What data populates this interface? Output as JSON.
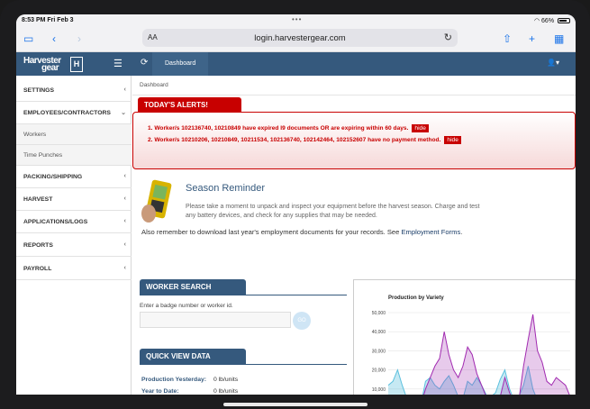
{
  "status_bar": {
    "time": "8:53 PM  Fri Feb 3",
    "battery": "66%"
  },
  "browser": {
    "text_size": "AA",
    "url": "login.harvestergear.com"
  },
  "header": {
    "logo_line1": "Harvester",
    "logo_line2": "gear",
    "logo_mark": "H",
    "nav_tab": "Dashboard"
  },
  "sidebar": {
    "items": [
      {
        "label": "SETTINGS"
      },
      {
        "label": "EMPLOYEES/CONTRACTORS"
      },
      {
        "label": "PACKING/SHIPPING"
      },
      {
        "label": "HARVEST"
      },
      {
        "label": "APPLICATIONS/LOGS"
      },
      {
        "label": "REPORTS"
      },
      {
        "label": "PAYROLL"
      }
    ],
    "subitems": [
      {
        "label": "Workers"
      },
      {
        "label": "Time Punches"
      }
    ]
  },
  "breadcrumb": "Dashboard",
  "alerts": {
    "title": "TODAY'S ALERTS!",
    "items": [
      {
        "text": "1.  Worker/s 102136740, 10210849 have expired I9 documents OR are expiring within 60 days.",
        "hide": "hide"
      },
      {
        "text": "2.  Worker/s 10210206, 10210849, 10211534, 102136740, 102142464, 102152607 have no payment method.",
        "hide": "hide"
      }
    ]
  },
  "reminder": {
    "title": "Season Reminder",
    "text": "Please take a moment to unpack and inspect your equipment before the harvest season. Charge and test any battery devices, and check for any supplies that may be needed.",
    "docs_text": "Also remember to download last year's employment documents for your records. See ",
    "docs_link": "Employment Forms",
    "docs_end": "."
  },
  "worker_search": {
    "title": "WORKER SEARCH",
    "label": "Enter a badge number or worker id.",
    "go": "GO"
  },
  "quick_view": {
    "title": "QUICK VIEW DATA",
    "rows": [
      {
        "label": "Production Yesterday:",
        "value": "0 lb/units"
      },
      {
        "label": "Year to Date:",
        "value": "0 lb/units"
      }
    ]
  },
  "colors": {
    "header": "#35597d",
    "alert": "#c80000",
    "series_a": "#5bc0de",
    "series_b": "#a12ab0",
    "series_c": "#d9534f"
  },
  "chart_data": {
    "type": "area",
    "title": "Production by Variety",
    "ylim": [
      0,
      50000
    ],
    "y_ticks": [
      "0",
      "10,000",
      "20,000",
      "30,000",
      "40,000",
      "50,000"
    ],
    "series": [
      {
        "values": [
          12000,
          14000,
          20000,
          12000,
          5000,
          4000,
          0,
          2000,
          14000,
          16000,
          12000,
          10000,
          14000,
          17000,
          12000,
          6000,
          5000,
          14000,
          12000,
          16000,
          12000,
          7000,
          6000,
          8000,
          15000,
          20000,
          10000,
          4000,
          6000,
          12000,
          22000,
          10000,
          4000,
          3000,
          2000,
          1000,
          1000,
          1500,
          1000,
          1000
        ]
      },
      {
        "values": [
          0,
          0,
          0,
          0,
          0,
          0,
          0,
          2000,
          10000,
          16000,
          22000,
          26000,
          40000,
          28000,
          20000,
          16000,
          22000,
          32000,
          28000,
          18000,
          12000,
          6000,
          4000,
          4000,
          6000,
          16000,
          8000,
          3000,
          4000,
          22000,
          36000,
          49000,
          30000,
          24000,
          14000,
          12000,
          16000,
          14000,
          12000,
          6000
        ]
      },
      {
        "values": [
          0,
          0,
          0,
          0,
          0,
          0,
          0,
          0,
          0,
          0,
          0,
          0,
          0,
          0,
          0,
          4000,
          0,
          0,
          2000,
          0,
          0,
          0,
          0,
          0,
          0,
          0,
          0,
          3000,
          5000,
          0,
          0,
          0,
          0,
          0,
          0,
          0,
          0,
          0,
          0,
          0
        ]
      }
    ]
  }
}
